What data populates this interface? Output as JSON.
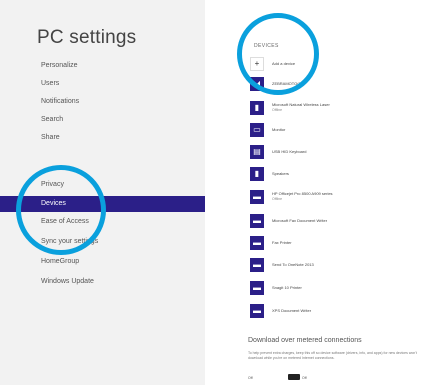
{
  "app": {
    "title": "PC settings"
  },
  "nav": {
    "items": [
      {
        "label": "Personalize",
        "selected": false
      },
      {
        "label": "Users",
        "selected": false
      },
      {
        "label": "Notifications",
        "selected": false
      },
      {
        "label": "Search",
        "selected": false
      },
      {
        "label": "Share",
        "selected": false
      },
      {
        "label": "Privacy",
        "selected": false
      },
      {
        "label": "Devices",
        "selected": true
      },
      {
        "label": "Ease of Access",
        "selected": false
      },
      {
        "label": "Sync your settings",
        "selected": false
      },
      {
        "label": "HomeGroup",
        "selected": false
      },
      {
        "label": "Windows Update",
        "selected": false
      }
    ]
  },
  "devices": {
    "heading": "DEVICES",
    "add_label": "Add a device",
    "items": [
      {
        "name": "ZEBRAMOTO(2)",
        "status": "",
        "icon": "speaker-icon"
      },
      {
        "name": "Microsoft Natural Wireless Laser",
        "status": "Offline",
        "icon": "keyboard-icon"
      },
      {
        "name": "Monitor",
        "status": "",
        "icon": "monitor-icon"
      },
      {
        "name": "USB HID Keyboard",
        "status": "",
        "icon": "keyboard-icon"
      },
      {
        "name": "Speakers",
        "status": "",
        "icon": "speaker-icon"
      },
      {
        "name": "HP Officejet Pro 8500 A909 series",
        "status": "Offline",
        "icon": "printer-icon"
      },
      {
        "name": "Microsoft Fax Document Writer",
        "status": "",
        "icon": "printer-icon"
      },
      {
        "name": "Fax Printer",
        "status": "",
        "icon": "printer-icon"
      },
      {
        "name": "Send To OneNote 2013",
        "status": "",
        "icon": "printer-icon"
      },
      {
        "name": "Snagit 10 Printer",
        "status": "",
        "icon": "printer-icon"
      },
      {
        "name": "XPS Document Writer",
        "status": "",
        "icon": "printer-icon"
      }
    ]
  },
  "download": {
    "title": "Download over metered connections",
    "description": "To help prevent extra charges, keep this off so device software (drivers, info, and apps) for new devices won't download while you're on metered Internet connections.",
    "toggle_label": "Off",
    "toggle_state": "Off"
  },
  "colors": {
    "accent": "#2b1f88",
    "highlight_ring": "#0aa0dd",
    "left_bg": "#f2f2f2"
  }
}
